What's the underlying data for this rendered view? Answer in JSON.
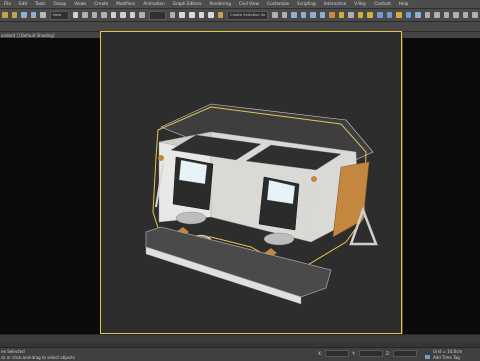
{
  "menubar": {
    "items": [
      "File",
      "Edit",
      "Tools",
      "Group",
      "Views",
      "Create",
      "Modifiers",
      "Animation",
      "Graph Editors",
      "Rendering",
      "Civil View",
      "Customize",
      "Scripting",
      "Interactive",
      "V-Ray",
      "Content",
      "Help"
    ]
  },
  "toolbar": {
    "selection_filter": "View",
    "named_selection_placeholder": "Create Selection Se"
  },
  "viewport": {
    "label": "andard ] [Default Shading]"
  },
  "status": {
    "selection_text": "ne Selected",
    "prompt_text": "ck or click-and-drag to select objects",
    "x_label": "X:",
    "y_label": "Y:",
    "z_label": "Z:",
    "grid_text": "Grid = 10,0cm",
    "add_time_tag": "Add Time Tag"
  },
  "colors": {
    "selection_outline": "#e8c547",
    "viewport_bg": "#2d2d2d",
    "ui_bg": "#444444",
    "wood": "#c4873f"
  }
}
